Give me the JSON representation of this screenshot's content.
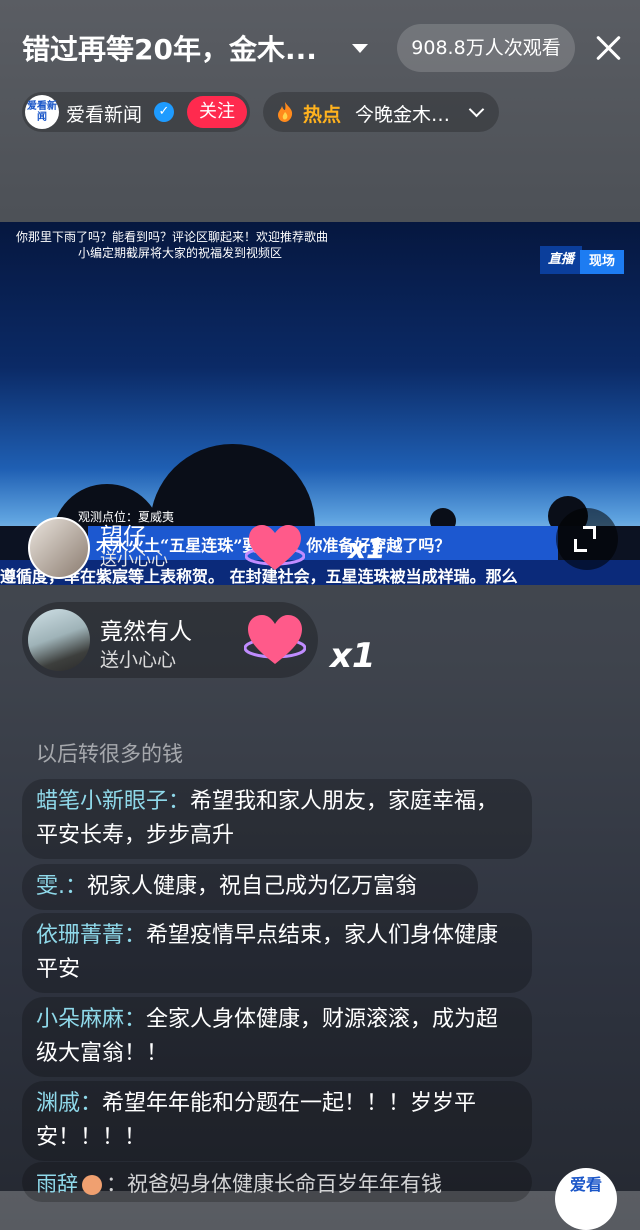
{
  "header": {
    "title": "错过再等20年，金木...",
    "viewers": "908.8万人次观看"
  },
  "anchor": {
    "logo_text": "爱看新闻",
    "name": "爱看新闻",
    "follow_label": "关注"
  },
  "hot": {
    "label": "热点",
    "text": "今晚金木…"
  },
  "video": {
    "caption_line1": "你那里下雨了吗？能看到吗？评论区聊起来！欢迎推荐歌曲",
    "caption_line2": "小编定期截屏将大家的祝福发到视频区",
    "live_badge_a": "直播",
    "live_badge_b": "现场",
    "location": "观测点位：夏威夷",
    "headline": "木水火土“五星连珠”要来了，你准备好穿越了吗？",
    "ticker": "遵循度，幸在紫宸等上表称贺。  在封建社会，五星连珠被当成祥瑞。那么"
  },
  "gifts": [
    {
      "user": "望仔",
      "action": "送小心心",
      "count": "x1"
    },
    {
      "user": "竟然有人",
      "action": "送小心心",
      "count": "x1"
    }
  ],
  "comments": {
    "faded": "以后转很多的钱",
    "items": [
      {
        "user": "蜡笔小新眼子：",
        "text": "希望我和家人朋友，家庭幸福，平安长寿，步步高升"
      },
      {
        "user": "雯.：",
        "text": "祝家人健康，祝自己成为亿万富翁"
      },
      {
        "user": "依珊菁菁：",
        "text": "希望疫情早点结束，家人们身体健康平安"
      },
      {
        "user": "小朵麻麻：",
        "text": "全家人身体健康，财源滚滚，成为超级大富翁！！"
      },
      {
        "user": "渊戚：",
        "text": "希望年年能和分题在一起！！！岁岁平安！！！！"
      }
    ],
    "bottom_user": "雨辞",
    "bottom_text": "：祝爸妈身体健康长命百岁年年有钱"
  },
  "brand_bubble": "爱看",
  "colors": {
    "follow": "#ff2a4e",
    "hot": "#ffb21e",
    "username": "#8fd9ea",
    "headline_bar": "#1c58d0"
  }
}
